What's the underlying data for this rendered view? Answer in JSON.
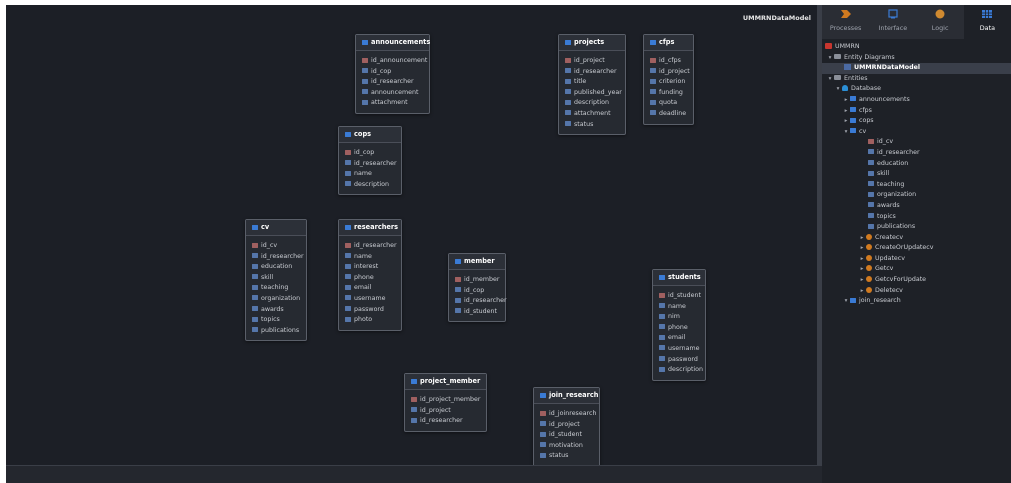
{
  "diagram": {
    "model_title": "UMMRNDataModel",
    "tables": [
      {
        "name": "announcements",
        "columns": [
          "id_announcement",
          "id_cop",
          "id_researcher",
          "announcement",
          "attachment"
        ]
      },
      {
        "name": "projects",
        "columns": [
          "id_project",
          "id_researcher",
          "title",
          "published_year",
          "description",
          "attachment",
          "status"
        ]
      },
      {
        "name": "cfps",
        "columns": [
          "id_cfps",
          "id_project",
          "criterion",
          "funding",
          "quota",
          "deadline"
        ]
      },
      {
        "name": "cops",
        "columns": [
          "id_cop",
          "id_researcher",
          "name",
          "description"
        ]
      },
      {
        "name": "cv",
        "columns": [
          "id_cv",
          "id_researcher",
          "education",
          "skill",
          "teaching",
          "organization",
          "awards",
          "topics",
          "publications"
        ]
      },
      {
        "name": "researchers",
        "columns": [
          "id_researcher",
          "name",
          "interest",
          "phone",
          "email",
          "username",
          "password",
          "photo"
        ]
      },
      {
        "name": "member",
        "columns": [
          "id_member",
          "id_cop",
          "id_researcher",
          "id_student"
        ]
      },
      {
        "name": "students",
        "columns": [
          "id_student",
          "name",
          "nim",
          "phone",
          "email",
          "username",
          "password",
          "description"
        ]
      },
      {
        "name": "project_member",
        "columns": [
          "id_project_member",
          "id_project",
          "id_researcher"
        ]
      },
      {
        "name": "join_research",
        "columns": [
          "id_joinresearch",
          "id_project",
          "id_student",
          "motivation",
          "status"
        ]
      }
    ]
  },
  "panel": {
    "tabs": [
      {
        "label": "Processes",
        "icon": "processes-icon",
        "active": false
      },
      {
        "label": "Interface",
        "icon": "interface-icon",
        "active": false
      },
      {
        "label": "Logic",
        "icon": "logic-icon",
        "active": false
      },
      {
        "label": "Data",
        "icon": "data-icon",
        "active": true
      }
    ],
    "tree": {
      "app": "UMMRN",
      "entity_diagrams": "Entity Diagrams",
      "data_model": "UMMRNDataModel",
      "entities": "Entities",
      "database": "Database",
      "db_entities": [
        "announcements",
        "cfps",
        "cops",
        "cv"
      ],
      "cv_attributes": [
        "id_cv",
        "id_researcher",
        "education",
        "skill",
        "teaching",
        "organization",
        "awards",
        "topics",
        "publications"
      ],
      "cv_actions": [
        "Createcv",
        "CreateOrUpdatecv",
        "Updatecv",
        "Getcv",
        "GetcvForUpdate",
        "Deletecv"
      ],
      "last_entity": "join_research"
    }
  },
  "colors": {
    "canvas": "#1c1f26",
    "panel": "#1e2127",
    "accent": "#3a7bd5",
    "pk": "#a06060",
    "action": "#d07a20",
    "app": "#c8362f"
  }
}
